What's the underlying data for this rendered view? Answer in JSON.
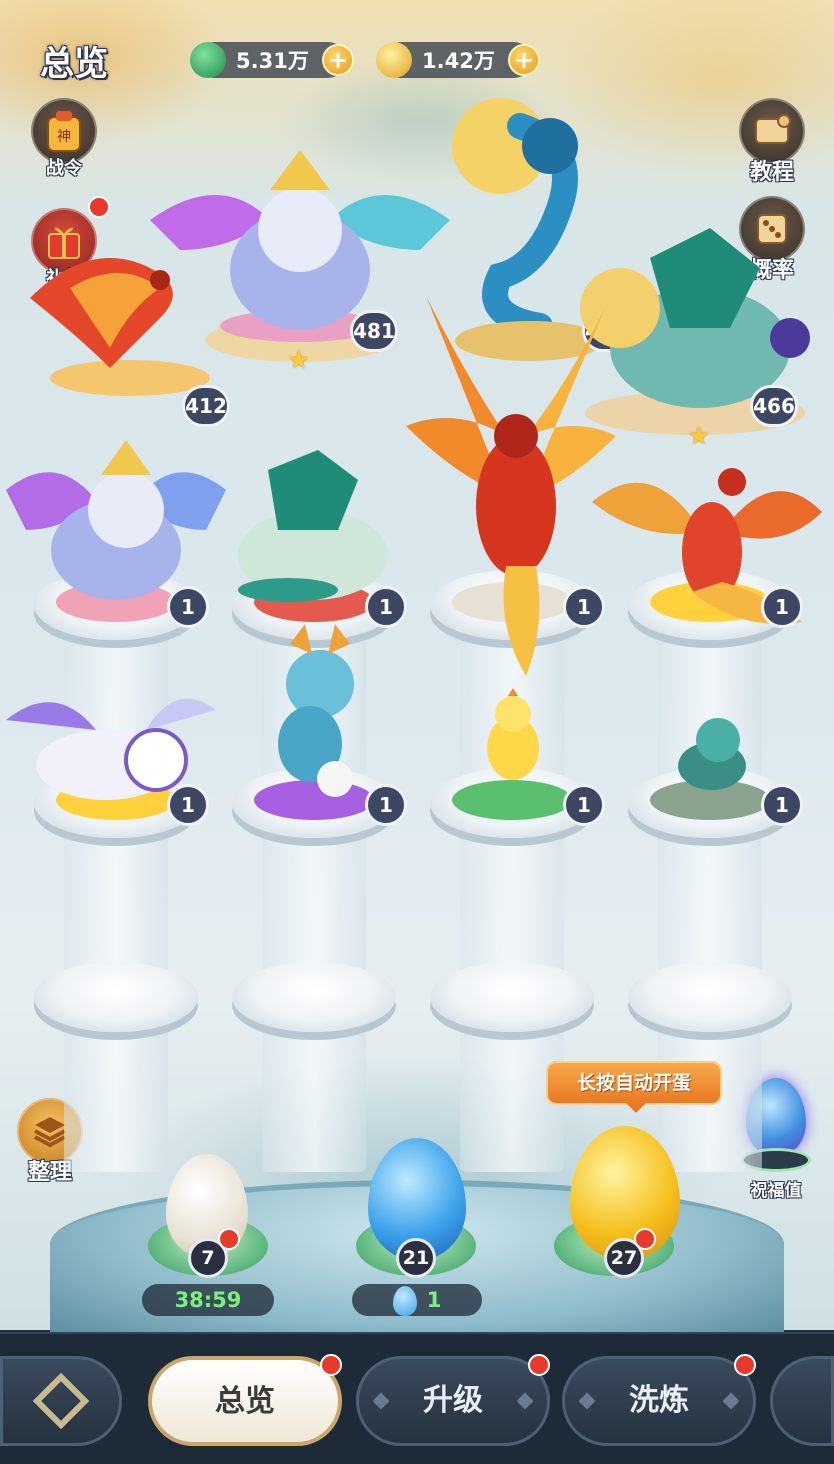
{
  "header": {
    "title": "总览",
    "currency_jade": {
      "icon": "jade-dragon-icon",
      "value": "5.31万"
    },
    "currency_gold": {
      "icon": "gold-coin-icon",
      "value": "1.42万"
    }
  },
  "side_left": {
    "battle_pass": {
      "icon": "battle-pass-icon",
      "label": "战令"
    },
    "gift_pack": {
      "icon": "gift-box-icon",
      "label": "礼包"
    },
    "sort": {
      "icon": "stack-layers-icon",
      "label": "整理"
    }
  },
  "side_right": {
    "tutorial": {
      "icon": "scroll-icon",
      "label": "教程"
    },
    "probability": {
      "icon": "dice-icon",
      "label": "概率"
    },
    "blessing": {
      "icon": "blessing-egg-icon",
      "label": "祝福值"
    }
  },
  "top_beasts": [
    {
      "name": "fire-phoenix",
      "level": "412"
    },
    {
      "name": "winged-qilin",
      "level": "481",
      "star": true
    },
    {
      "name": "azure-dragon",
      "level": "440"
    },
    {
      "name": "jade-turtle",
      "level": "466",
      "star": true
    }
  ],
  "pedestal_row1": [
    {
      "creature": "winged-qilin",
      "pad_color": "#f0a2b6",
      "level": "1"
    },
    {
      "creature": "jade-turtle",
      "pad_color": "#e45a4e",
      "level": "1"
    },
    {
      "creature": "flame-phoenix",
      "pad_color": "#e6e1d4",
      "level": "1"
    },
    {
      "creature": "red-phoenix",
      "pad_color": "#ffd23d",
      "level": "1"
    }
  ],
  "pedestal_row2": [
    {
      "creature": "white-tiger",
      "pad_color": "#ffd23d",
      "level": "1"
    },
    {
      "creature": "baby-dragon",
      "pad_color": "#a65fe0",
      "level": "1"
    },
    {
      "creature": "yellow-chick",
      "pad_color": "#5ac06e",
      "level": "1"
    },
    {
      "creature": "baby-turtle",
      "pad_color": "#8aa38f",
      "level": "1"
    }
  ],
  "eggs": {
    "tooltip": "长按自动开蛋",
    "white": {
      "count": "7",
      "timer": "38:59"
    },
    "blue": {
      "count": "21",
      "extra": "1"
    },
    "gold": {
      "count": "27"
    }
  },
  "nav": {
    "menu_icon": "diamond-logo-icon",
    "tabs": [
      "总览",
      "升级",
      "洗炼"
    ]
  }
}
